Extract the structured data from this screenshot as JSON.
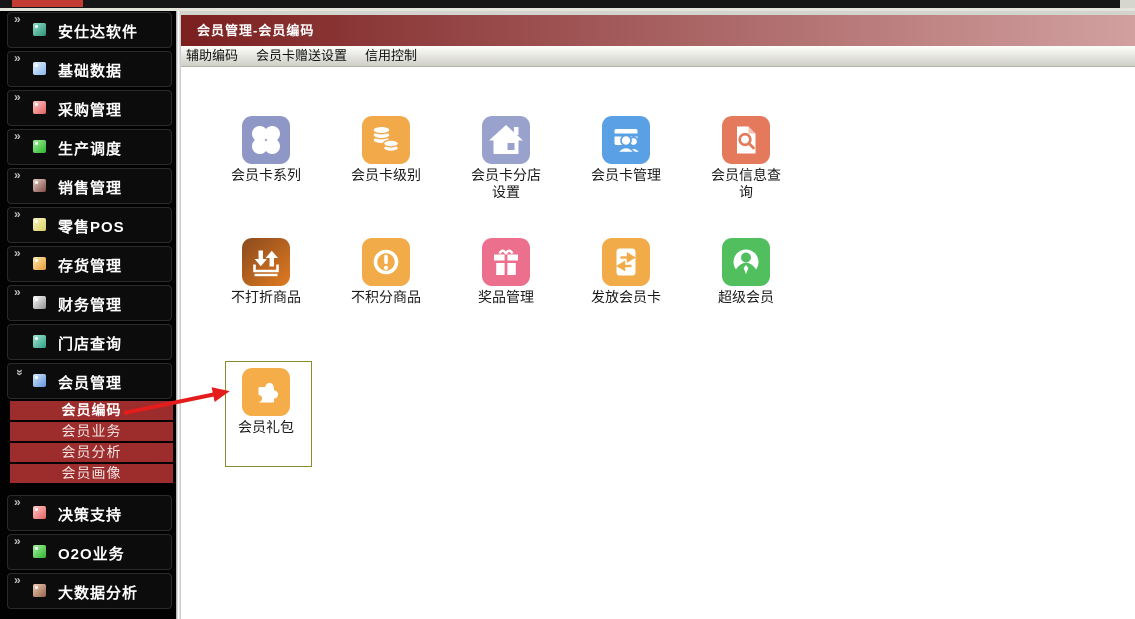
{
  "colors": {
    "tab": "#c23c34",
    "titlebar_left": "#7b1f1f",
    "titlebar_right": "#d2a0a0",
    "submenu_bg": "#9d2c2c",
    "selection_border": "#8a8a2e",
    "arrow": "#e51c1c"
  },
  "titlebar": {
    "title": "会员管理-会员编码"
  },
  "menubar": {
    "items": [
      "辅助编码",
      "会员卡赠送设置",
      "信用控制"
    ]
  },
  "sidebar": {
    "items": [
      {
        "type": "main",
        "id": "software",
        "label": "安仕达软件",
        "chevron": "right",
        "icon": "software-icon",
        "colors": [
          "#8fe0cb",
          "#2f8f77"
        ]
      },
      {
        "type": "main",
        "id": "base-data",
        "label": "基础数据",
        "chevron": "right",
        "icon": "base-data-icon",
        "colors": [
          "#e8f2fd",
          "#86b6ea"
        ]
      },
      {
        "type": "main",
        "id": "purchase",
        "label": "采购管理",
        "chevron": "right",
        "icon": "purchase-icon",
        "colors": [
          "#ffc9c9",
          "#e35f5f"
        ]
      },
      {
        "type": "main",
        "id": "production",
        "label": "生产调度",
        "chevron": "right",
        "icon": "production-icon",
        "colors": [
          "#9ef09a",
          "#2db52d"
        ]
      },
      {
        "type": "main",
        "id": "sales",
        "label": "销售管理",
        "chevron": "right",
        "icon": "sales-icon",
        "colors": [
          "#e6cfc8",
          "#7e4a40"
        ]
      },
      {
        "type": "main",
        "id": "retail-pos",
        "label": "零售POS",
        "chevron": "right",
        "icon": "retail-pos-icon",
        "colors": [
          "#fbf7c0",
          "#d9cd62"
        ]
      },
      {
        "type": "main",
        "id": "inventory",
        "label": "存货管理",
        "chevron": "right",
        "icon": "inventory-icon",
        "colors": [
          "#fdeaa8",
          "#e39a3b"
        ]
      },
      {
        "type": "main",
        "id": "finance",
        "label": "财务管理",
        "chevron": "right",
        "icon": "finance-icon",
        "colors": [
          "#ffffff",
          "#8f8f8f"
        ]
      },
      {
        "type": "main",
        "id": "store-query",
        "label": "门店查询",
        "chevron": "none",
        "icon": "store-query-icon",
        "colors": [
          "#9fe7d2",
          "#2f9f85"
        ]
      },
      {
        "type": "main",
        "id": "member-mgmt",
        "label": "会员管理",
        "chevron": "down",
        "icon": "member-mgmt-icon",
        "colors": [
          "#d6e8fb",
          "#5e93da"
        ]
      },
      {
        "type": "sub",
        "id": "member-code",
        "label": "会员编码",
        "selected": true
      },
      {
        "type": "sub",
        "id": "member-business",
        "label": "会员业务",
        "selected": false
      },
      {
        "type": "sub",
        "id": "member-analysis",
        "label": "会员分析",
        "selected": false
      },
      {
        "type": "sub",
        "id": "member-portrait",
        "label": "会员画像",
        "selected": false
      },
      {
        "type": "main",
        "id": "decision",
        "label": "决策支持",
        "chevron": "right",
        "icon": "decision-icon",
        "colors": [
          "#ffc9c9",
          "#e35f5f"
        ]
      },
      {
        "type": "main",
        "id": "o2o",
        "label": "O2O业务",
        "chevron": "right",
        "icon": "o2o-icon",
        "colors": [
          "#a8f2a2",
          "#2eb22e"
        ]
      },
      {
        "type": "main",
        "id": "bigdata",
        "label": "大数据分析",
        "chevron": "right",
        "icon": "bigdata-icon",
        "colors": [
          "#eccdb2",
          "#96604a"
        ]
      }
    ]
  },
  "content": {
    "tiles": [
      {
        "label": "会员卡系列",
        "icon": "clover-icon",
        "color": "#8e97c5",
        "col": 0,
        "row": 0,
        "selected": false
      },
      {
        "label": "会员卡级别",
        "icon": "coins-icon",
        "color": "#f2a94a",
        "col": 1,
        "row": 0,
        "selected": false
      },
      {
        "label": "会员卡分店\n设置",
        "icon": "home-icon",
        "color": "#99a2cc",
        "col": 2,
        "row": 0,
        "selected": false
      },
      {
        "label": "会员卡管理",
        "icon": "card-people-icon",
        "color": "#59a0e4",
        "col": 3,
        "row": 0,
        "selected": false
      },
      {
        "label": "会员信息查\n询",
        "icon": "doc-search-icon",
        "color": "#e4795c",
        "col": 4,
        "row": 0,
        "selected": false
      },
      {
        "label": "不打折商品",
        "icon": "import-icon",
        "color": "#c56a22",
        "color2": "#8a4a1e",
        "color3": "#e07a20",
        "col": 0,
        "row": 1,
        "selected": false
      },
      {
        "label": "不积分商品",
        "icon": "exclaim-icon",
        "color": "#f2ab49",
        "col": 1,
        "row": 1,
        "selected": false
      },
      {
        "label": "奖品管理",
        "icon": "gift-icon",
        "color": "#ec6f8e",
        "col": 2,
        "row": 1,
        "selected": false
      },
      {
        "label": "发放会员卡",
        "icon": "transfer-icon",
        "color": "#f2ab49",
        "col": 3,
        "row": 1,
        "selected": false
      },
      {
        "label": "超级会员",
        "icon": "person-icon",
        "color": "#52bf5e",
        "col": 4,
        "row": 1,
        "selected": false
      },
      {
        "label": "会员礼包",
        "icon": "puzzle-icon",
        "color": "#f5ad49",
        "col": 0,
        "row": 2,
        "selected": true
      }
    ]
  }
}
